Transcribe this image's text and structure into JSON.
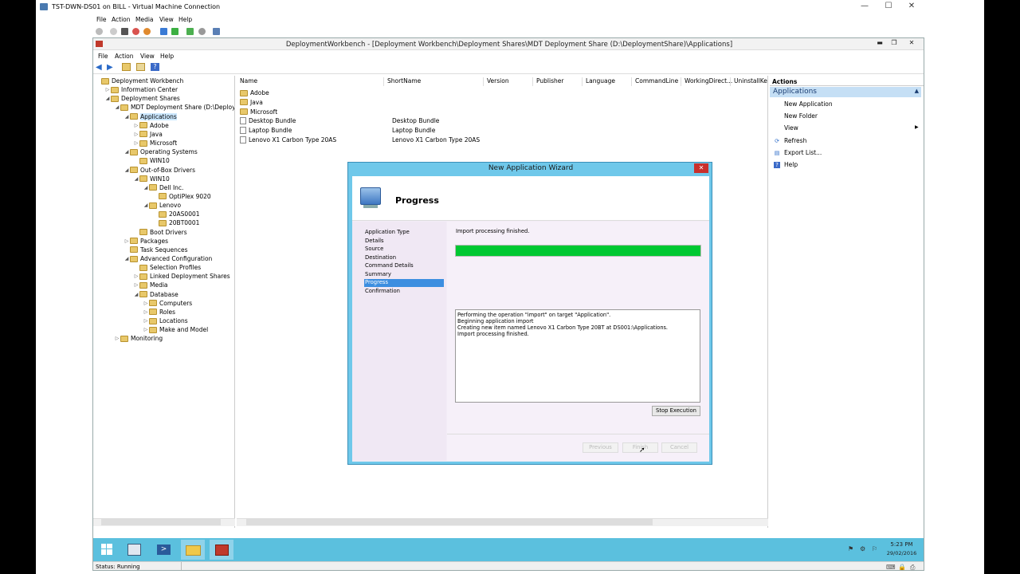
{
  "vm": {
    "title": "TST-DWN-DS01 on BILL - Virtual Machine Connection",
    "menu": [
      "File",
      "Action",
      "Media",
      "View",
      "Help"
    ],
    "status": "Status: Running"
  },
  "mmc": {
    "title": "DeploymentWorkbench - [Deployment Workbench\\Deployment Shares\\MDT Deployment Share (D:\\DeploymentShare)\\Applications]",
    "menu": [
      "File",
      "Action",
      "View",
      "Help"
    ]
  },
  "tree": [
    {
      "label": "Deployment Workbench",
      "indent": 0,
      "exp": ""
    },
    {
      "label": "Information Center",
      "indent": 1,
      "exp": "▷"
    },
    {
      "label": "Deployment Shares",
      "indent": 1,
      "exp": "◢"
    },
    {
      "label": "MDT Deployment Share (D:\\DeploymentS",
      "indent": 2,
      "exp": "◢"
    },
    {
      "label": "Applications",
      "indent": 3,
      "exp": "◢",
      "selected": true
    },
    {
      "label": "Adobe",
      "indent": 4,
      "exp": "▷"
    },
    {
      "label": "Java",
      "indent": 4,
      "exp": "▷"
    },
    {
      "label": "Microsoft",
      "indent": 4,
      "exp": "▷"
    },
    {
      "label": "Operating Systems",
      "indent": 3,
      "exp": "◢"
    },
    {
      "label": "WIN10",
      "indent": 4,
      "exp": ""
    },
    {
      "label": "Out-of-Box Drivers",
      "indent": 3,
      "exp": "◢"
    },
    {
      "label": "WIN10",
      "indent": 4,
      "exp": "◢"
    },
    {
      "label": "Dell Inc.",
      "indent": 5,
      "exp": "◢"
    },
    {
      "label": "OptiPlex 9020",
      "indent": 6,
      "exp": ""
    },
    {
      "label": "Lenovo",
      "indent": 5,
      "exp": "◢"
    },
    {
      "label": "20AS0001",
      "indent": 6,
      "exp": ""
    },
    {
      "label": "20BT0001",
      "indent": 6,
      "exp": ""
    },
    {
      "label": "Boot Drivers",
      "indent": 4,
      "exp": ""
    },
    {
      "label": "Packages",
      "indent": 3,
      "exp": "▷"
    },
    {
      "label": "Task Sequences",
      "indent": 3,
      "exp": ""
    },
    {
      "label": "Advanced Configuration",
      "indent": 3,
      "exp": "◢"
    },
    {
      "label": "Selection Profiles",
      "indent": 4,
      "exp": ""
    },
    {
      "label": "Linked Deployment Shares",
      "indent": 4,
      "exp": "▷"
    },
    {
      "label": "Media",
      "indent": 4,
      "exp": "▷"
    },
    {
      "label": "Database",
      "indent": 4,
      "exp": "◢"
    },
    {
      "label": "Computers",
      "indent": 5,
      "exp": "▷"
    },
    {
      "label": "Roles",
      "indent": 5,
      "exp": "▷"
    },
    {
      "label": "Locations",
      "indent": 5,
      "exp": "▷"
    },
    {
      "label": "Make and Model",
      "indent": 5,
      "exp": "▷"
    },
    {
      "label": "Monitoring",
      "indent": 2,
      "exp": "▷"
    }
  ],
  "list": {
    "columns": [
      "Name",
      "ShortName",
      "Version",
      "Publisher",
      "Language",
      "CommandLine",
      "WorkingDirect...",
      "UninstallKey"
    ],
    "rows": [
      {
        "name": "Adobe",
        "short": "",
        "folder": true
      },
      {
        "name": "Java",
        "short": "",
        "folder": true
      },
      {
        "name": "Microsoft",
        "short": "",
        "folder": true
      },
      {
        "name": "Desktop Bundle",
        "short": "Desktop Bundle",
        "folder": false
      },
      {
        "name": "Laptop Bundle",
        "short": "Laptop Bundle",
        "folder": false
      },
      {
        "name": "Lenovo X1 Carbon Type 20AS",
        "short": "Lenovo X1 Carbon Type 20AS",
        "folder": false
      }
    ]
  },
  "actions": {
    "header": "Actions",
    "section": "Applications",
    "items": [
      "New Application",
      "New Folder",
      "View",
      "Refresh",
      "Export List...",
      "Help"
    ]
  },
  "wizard": {
    "title": "New Application Wizard",
    "heading": "Progress",
    "steps": [
      "Application Type",
      "Details",
      "Source",
      "Destination",
      "Command Details",
      "Summary",
      "Progress",
      "Confirmation"
    ],
    "current_step": "Progress",
    "status": "Import processing finished.",
    "progress": 1.0,
    "log": [
      "Performing the operation \"import\" on target \"Application\".",
      "Beginning application import",
      "Creating new item named Lenovo X1 Carbon Type 20BT at DS001:\\Applications.",
      "Import processing finished."
    ],
    "stop_label": "Stop Execution",
    "previous_label": "Previous",
    "finish_label": "Finish",
    "cancel_label": "Cancel"
  },
  "clock": {
    "time": "5:23 PM",
    "date": "29/02/2016"
  },
  "colors": {
    "progress": "#00c832",
    "taskbar": "#5bc0de",
    "selected_step": "#3c8ee0",
    "wizard_frame": "#6fc8ea"
  }
}
